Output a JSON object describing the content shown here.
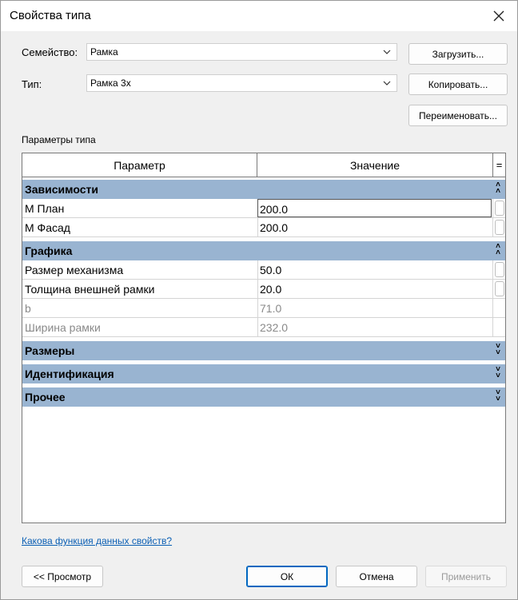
{
  "window": {
    "title": "Свойства типа"
  },
  "family": {
    "label": "Семейство:",
    "value": "Рамка"
  },
  "type": {
    "label": "Тип:",
    "value": "Рамка 3x"
  },
  "buttons": {
    "load": "Загрузить...",
    "copy": "Копировать...",
    "rename": "Переименовать...",
    "preview": "<< Просмотр",
    "ok": "ОК",
    "cancel": "Отмена",
    "apply": "Применить"
  },
  "section_label": "Параметры типа",
  "grid": {
    "headers": [
      "Параметр",
      "Значение",
      "="
    ],
    "groups": [
      {
        "name": "Зависимости",
        "state": "expanded",
        "rows": [
          {
            "name": "М План",
            "value": "200.0",
            "editable": true
          },
          {
            "name": "М Фасад",
            "value": "200.0",
            "editable": true
          }
        ]
      },
      {
        "name": "Графика",
        "state": "expanded",
        "rows": [
          {
            "name": "Размер механизма",
            "value": "50.0",
            "editable": true
          },
          {
            "name": "Толщина внешней рамки",
            "value": "20.0",
            "editable": true
          },
          {
            "name": "b",
            "value": "71.0",
            "editable": false
          },
          {
            "name": "Ширина рамки",
            "value": "232.0",
            "editable": false
          }
        ]
      },
      {
        "name": "Размеры",
        "state": "collapsed",
        "rows": []
      },
      {
        "name": "Идентификация",
        "state": "collapsed",
        "rows": []
      },
      {
        "name": "Прочее",
        "state": "collapsed",
        "rows": []
      }
    ]
  },
  "help_link": "Какова функция данных свойств?",
  "icons": {
    "close": "close-icon",
    "dropdown": "chevron-down-icon",
    "collapse": "double-chevron-up-icon",
    "expand": "double-chevron-down-icon"
  },
  "colors": {
    "group_header": "#99b4d1",
    "link": "#0a5fb4",
    "primary_border": "#0067c0"
  }
}
